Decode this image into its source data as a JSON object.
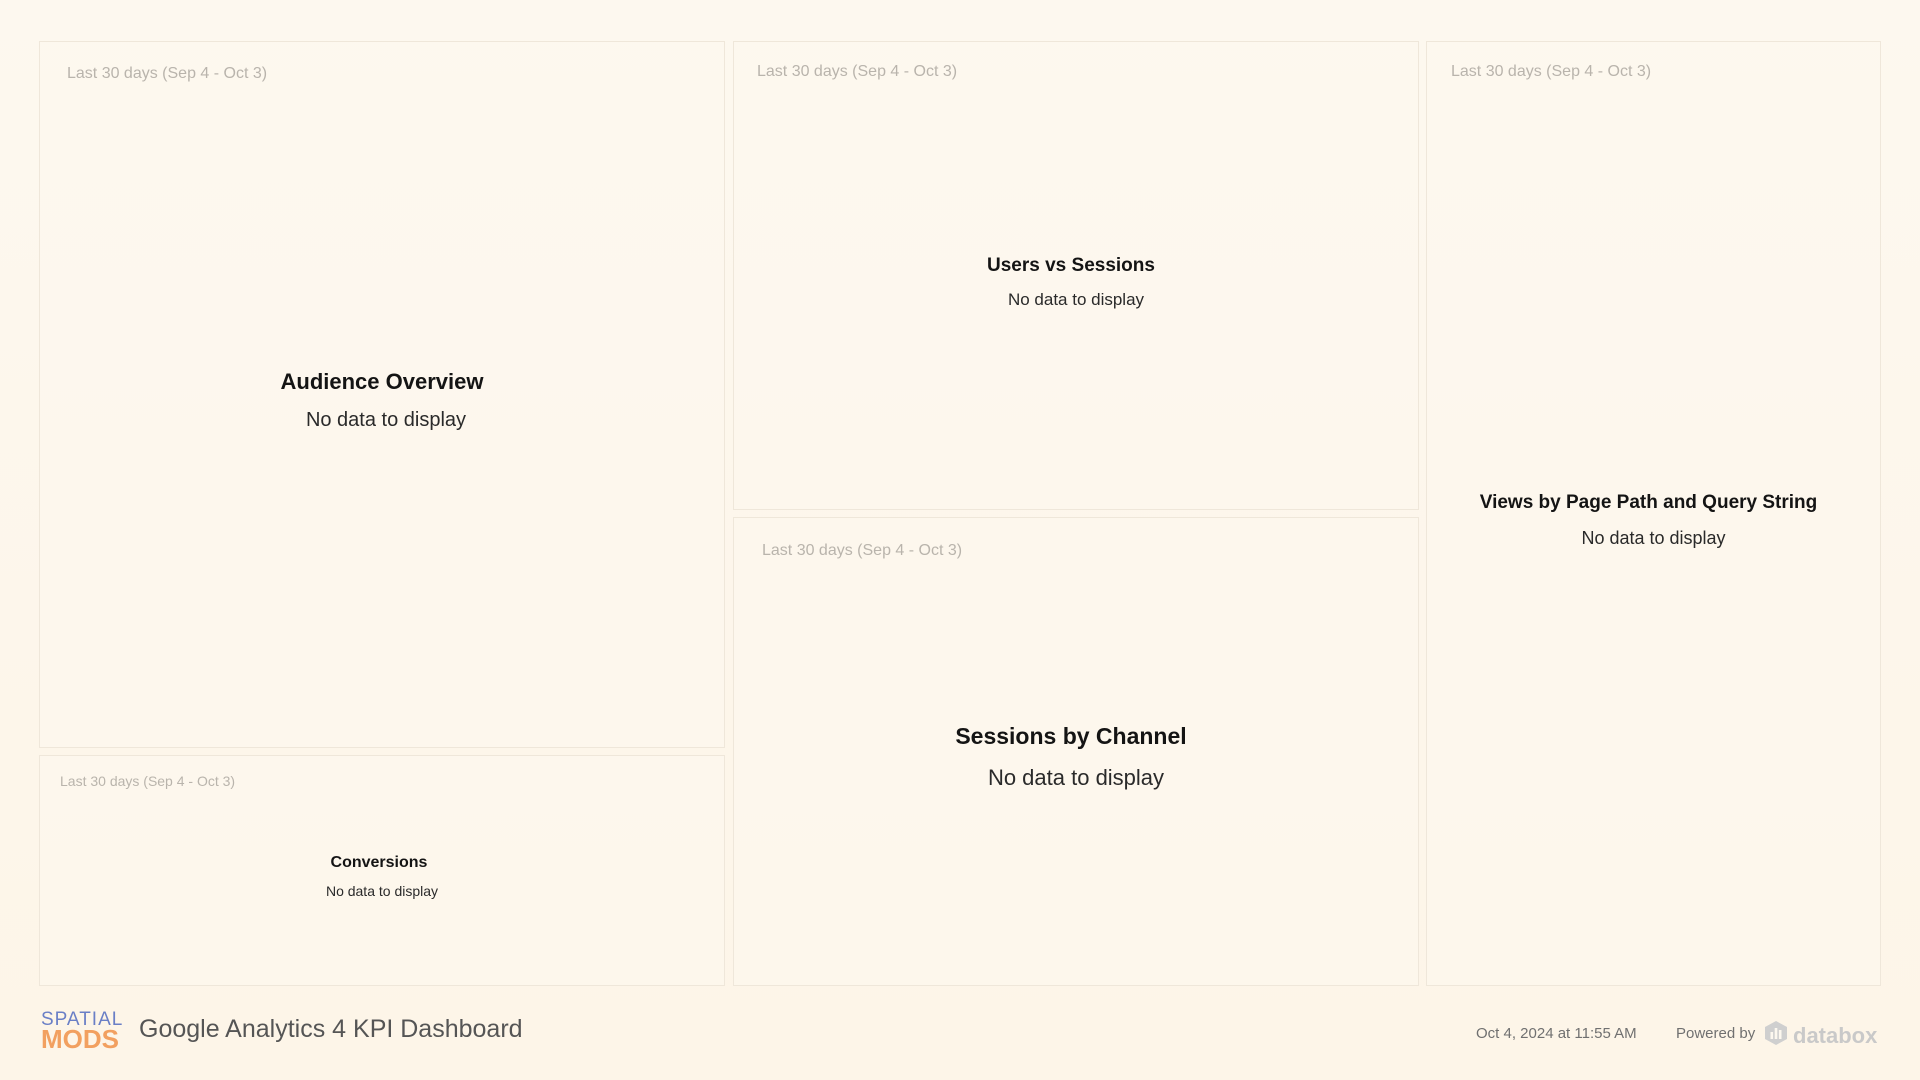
{
  "panels": {
    "audience": {
      "range": "Last 30 days (Sep 4 - Oct 3)",
      "title": "Audience Overview",
      "message": "No data to display"
    },
    "conversions": {
      "range": "Last 30 days (Sep 4 - Oct 3)",
      "title": "Conversions",
      "message": "No data to display"
    },
    "users_sessions": {
      "range": "Last 30 days (Sep 4 - Oct 3)",
      "title": "Users vs Sessions",
      "message": "No data to display"
    },
    "sessions_channel": {
      "range": "Last 30 days (Sep 4 - Oct 3)",
      "title": "Sessions by Channel",
      "message": "No data to display"
    },
    "views_page_path": {
      "range": "Last 30 days (Sep 4 - Oct 3)",
      "title": "Views by Page Path and Query String",
      "message": "No data to display"
    }
  },
  "footer": {
    "logo_top": "SPATIAL",
    "logo_bottom": "MODS",
    "dashboard_title": "Google Analytics 4 KPI Dashboard",
    "timestamp": "Oct 4, 2024 at 11:55 AM",
    "powered_by": "Powered by",
    "brand": "databox",
    "brand_icon": "databox-logo-icon"
  },
  "colors": {
    "background": "#fdf8ef",
    "panel_border": "#efe7da",
    "logo_blue": "#6a7fc6",
    "logo_orange": "#f2a060",
    "brand_gray": "#c9c9c9"
  }
}
